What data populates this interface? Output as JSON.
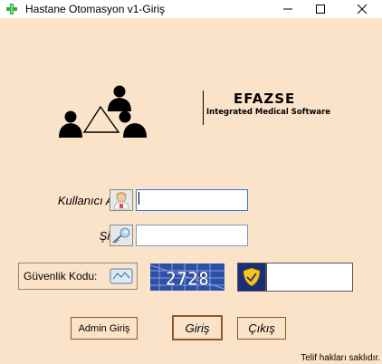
{
  "window": {
    "title": "Hastane Otomasyon v1-Giriş",
    "controls": [
      "minimize-icon",
      "maximize-icon",
      "close-icon"
    ]
  },
  "brand": {
    "name": "EFAZSE",
    "subtitle": "Integrated Medical Software"
  },
  "form": {
    "username_label": "Kullanıcı Adı:",
    "username_value": "",
    "password_label": "Şifre:",
    "password_value": "",
    "security_label": "Güvenlik Kodu:",
    "captcha_text": "2728",
    "captcha_value": ""
  },
  "buttons": {
    "admin_login": "Admin Giriş",
    "login": "Giriş",
    "exit": "Çıkış"
  },
  "footer": {
    "copyright": "Telif hakları saklıdır."
  },
  "colors": {
    "background": "#fbe3c9",
    "button_border": "#8b5a2b",
    "captcha_bg": "#2d4fa8",
    "shield_bg": "#1c2e7a"
  }
}
